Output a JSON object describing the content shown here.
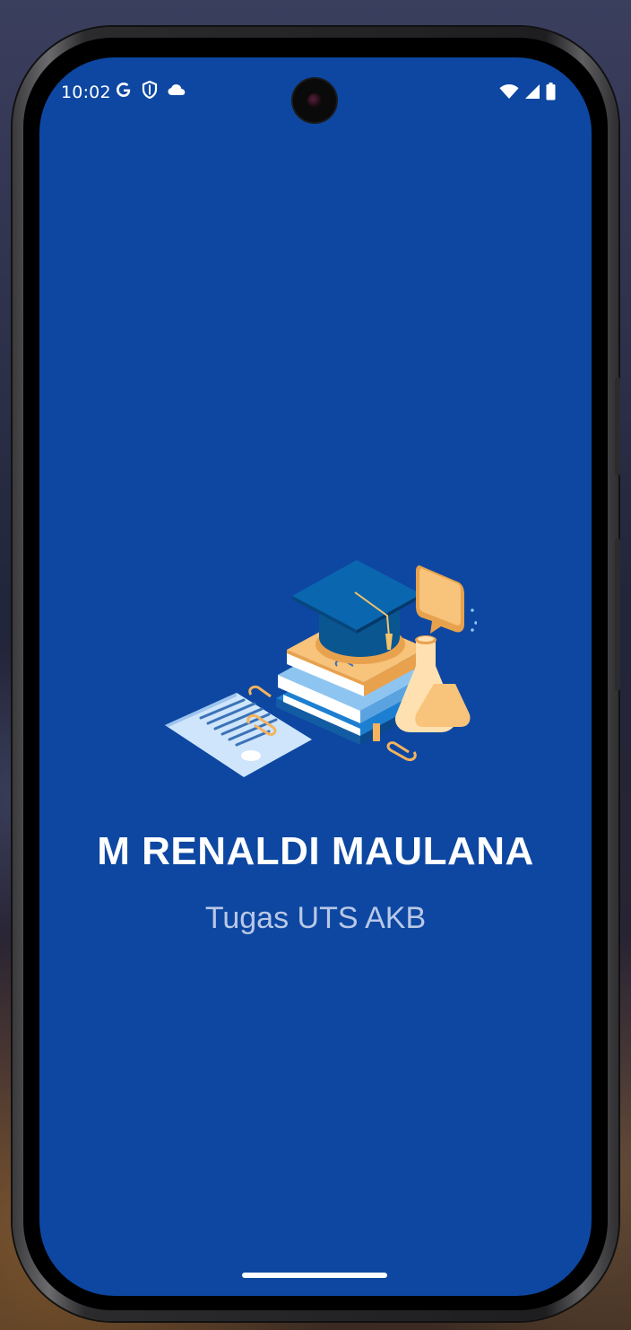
{
  "status_bar": {
    "time": "10:02",
    "left_icons": [
      "google-icon",
      "shield-icon",
      "cloud-icon"
    ],
    "right_icons": [
      "wifi-icon",
      "signal-icon",
      "battery-icon"
    ]
  },
  "splash": {
    "title": "M RENALDI MAULANA",
    "subtitle": "Tugas UTS AKB",
    "illustration": "education-illustration"
  },
  "colors": {
    "background": "#0d47a1",
    "title": "#ffffff",
    "subtitle": "#b9c8e6"
  }
}
